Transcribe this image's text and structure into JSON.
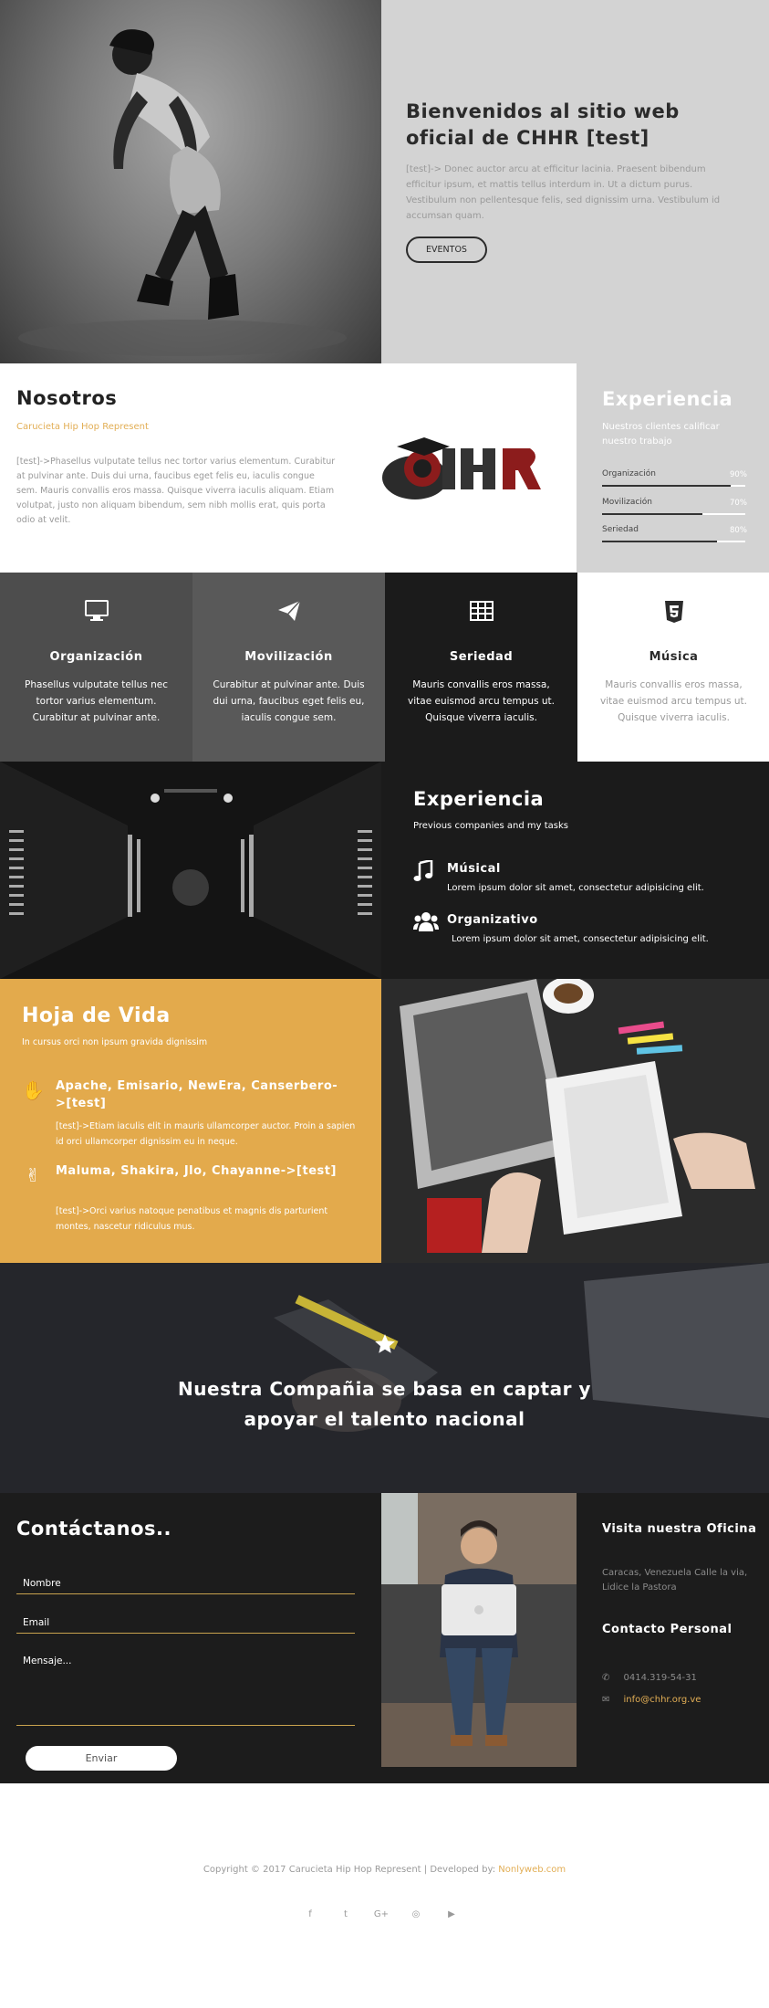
{
  "hero": {
    "title": "Bienvenidos al sitio web oficial de CHHR [test]",
    "text": "[test]-> Donec auctor arcu at efficitur lacinia. Praesent bibendum efficitur ipsum, et mattis tellus interdum in. Ut a dictum purus. Vestibulum non pellentesque felis, sed dignissim urna. Vestibulum id accumsan quam.",
    "button": "EVENTOS"
  },
  "about": {
    "title": "Nosotros",
    "subtitle": "Carucieta Hip Hop Represent",
    "text": "[test]->Phasellus vulputate tellus nec tortor varius elementum. Curabitur at pulvinar ante. Duis dui urna, faucibus eget felis eu, iaculis congue sem. Mauris convallis eros massa. Quisque viverra iaculis aliquam. Etiam volutpat, justo non aliquam bibendum, sem nibh mollis erat, quis porta odio at velit.",
    "logo_text": "CHHR"
  },
  "experience_panel": {
    "title": "Experiencia",
    "text": "Nuestros clientes calificar nuestro trabajo",
    "bars": [
      {
        "label": "Organización",
        "value": "90%",
        "fraction": 0.9
      },
      {
        "label": "Movilización",
        "value": "70%",
        "fraction": 0.7
      },
      {
        "label": "Seriedad",
        "value": "80%",
        "fraction": 0.8
      }
    ]
  },
  "services": [
    {
      "icon": "monitor-icon",
      "title": "Organización",
      "text": "Phasellus vulputate tellus nec tortor varius elementum. Curabitur at pulvinar ante.",
      "bg": "#4d4d4d"
    },
    {
      "icon": "paper-plane-icon",
      "title": "Movilización",
      "text": "Curabitur at pulvinar ante. Duis dui urna, faucibus eget felis eu, iaculis congue sem.",
      "bg": "#595959"
    },
    {
      "icon": "table-icon",
      "title": "Seriedad",
      "text": "Mauris convallis eros massa, vitae euismod arcu tempus ut. Quisque viverra iaculis.",
      "bg": "#1b1b1b"
    },
    {
      "icon": "html5-icon",
      "title": "Música",
      "text": "Mauris convallis eros massa, vitae euismod arcu tempus ut. Quisque viverra iaculis.",
      "bg": "#ffffff"
    }
  ],
  "experience_dark": {
    "title": "Experiencia",
    "subtitle": "Previous companies and my tasks",
    "items": [
      {
        "icon": "music-note-icon",
        "title": "Músical",
        "text": "Lorem ipsum dolor sit amet, consectetur adipisicing elit."
      },
      {
        "icon": "group-icon",
        "title": "Organizativo",
        "text": "Lorem ipsum dolor sit amet, consectetur adipisicing elit."
      }
    ]
  },
  "cv": {
    "title": "Hoja de Vida",
    "subtitle": "In cursus orci non ipsum gravida dignissim",
    "items": [
      {
        "icon": "hand-icon",
        "title": "Apache, Emisario, NewEra, Canserbero->[test]",
        "text": "[test]->Etiam iaculis elit in mauris ullamcorper auctor. Proin a sapien id orci ullamcorper dignissim eu in neque."
      },
      {
        "icon": "peace-hand-icon",
        "title": "Maluma, Shakira, Jlo, Chayanne->[test]",
        "text": "[test]->Orci varius natoque penatibus et magnis dis parturient montes, nascetur ridiculus mus."
      }
    ]
  },
  "banner": {
    "line1": "Nuestra Compañia se basa en captar y",
    "line2": "apoyar el talento nacional"
  },
  "contact": {
    "title": "Contáctanos..",
    "name_placeholder": "Nombre",
    "email_placeholder": "Email",
    "message_placeholder": "Mensaje...",
    "send": "Enviar",
    "visit_title": "Visita nuestra Oficina",
    "address": "Caracas, Venezuela Calle la via, Lidice la Pastora",
    "personal_title": "Contacto Personal",
    "phone": "0414.319-54-31",
    "email": "info@chhr.org.ve"
  },
  "footer": {
    "copyright": "Copyright © 2017 Carucieta Hip Hop Represent | Developed by:",
    "developer": "Nonlyweb.com",
    "social": [
      {
        "icon": "facebook-icon",
        "glyph": "f"
      },
      {
        "icon": "twitter-icon",
        "glyph": "t"
      },
      {
        "icon": "google-plus-icon",
        "glyph": "G+"
      },
      {
        "icon": "instagram-icon",
        "glyph": "◎"
      },
      {
        "icon": "youtube-icon",
        "glyph": "▶"
      }
    ]
  },
  "colors": {
    "accent": "#e2ae55",
    "dark": "#1b1b1b",
    "light_gray": "#d3d3d3"
  }
}
